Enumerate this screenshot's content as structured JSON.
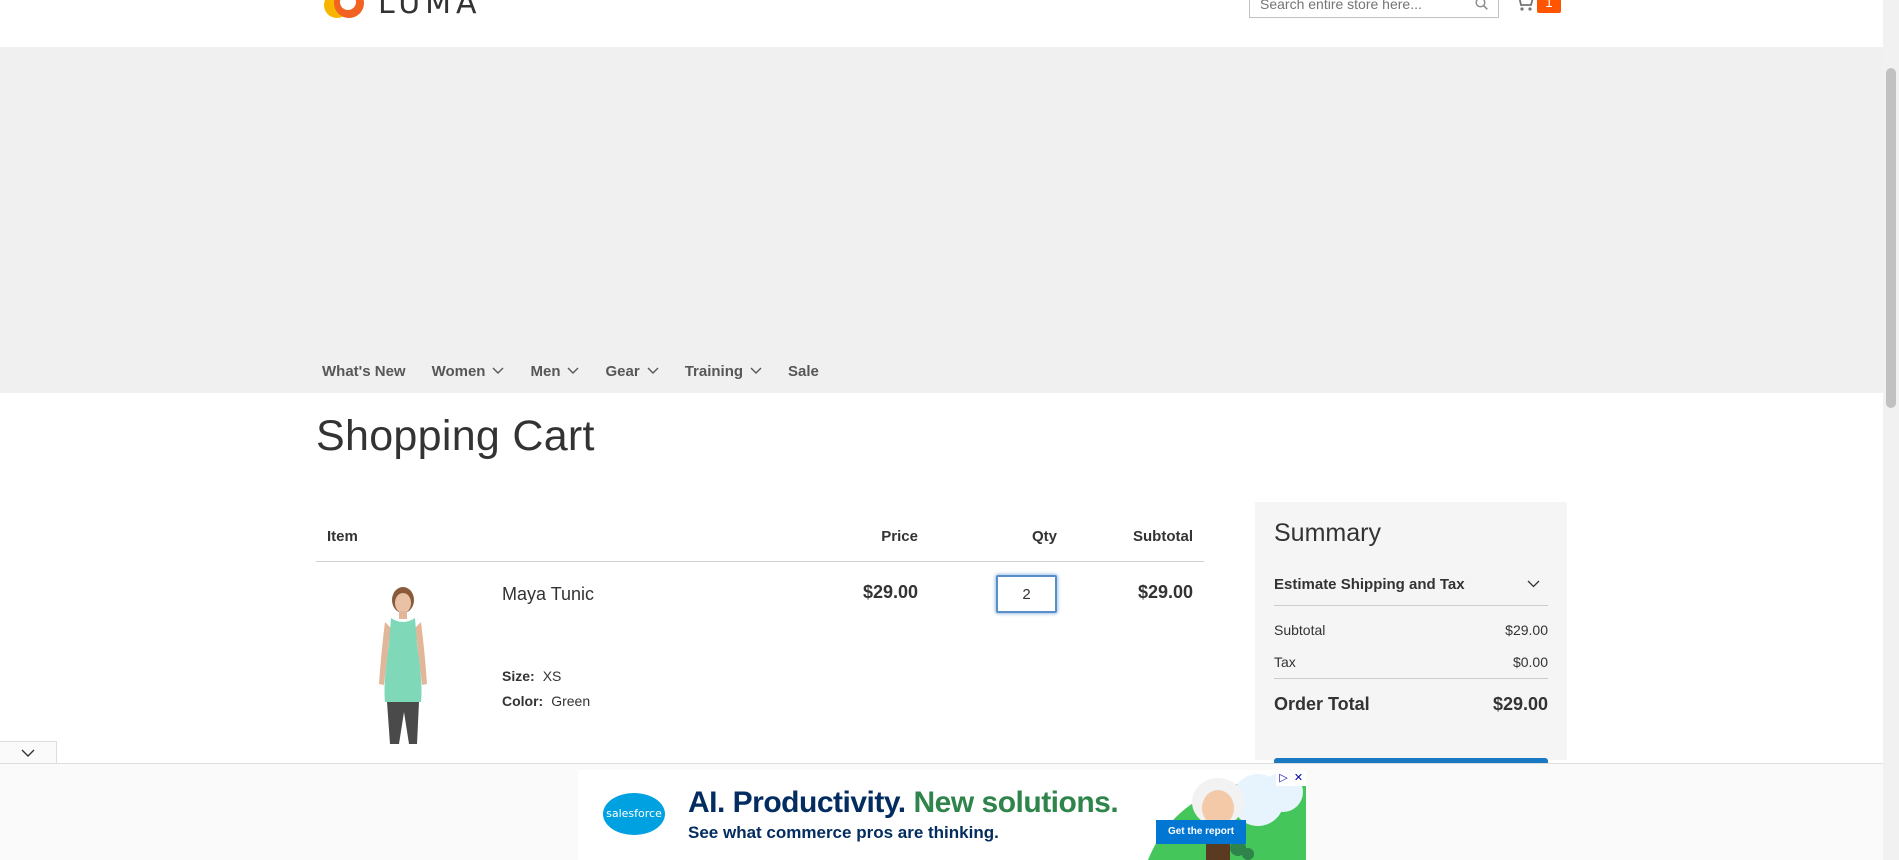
{
  "header": {
    "logo_text": "LUMA",
    "search_placeholder": "Search entire store here...",
    "cart_count": "1"
  },
  "nav": {
    "items": [
      {
        "label": "What's New",
        "has_dropdown": false
      },
      {
        "label": "Women",
        "has_dropdown": true
      },
      {
        "label": "Men",
        "has_dropdown": true
      },
      {
        "label": "Gear",
        "has_dropdown": true
      },
      {
        "label": "Training",
        "has_dropdown": true
      },
      {
        "label": "Sale",
        "has_dropdown": false
      }
    ]
  },
  "page": {
    "title": "Shopping Cart"
  },
  "cart": {
    "columns": {
      "item": "Item",
      "price": "Price",
      "qty": "Qty",
      "subtotal": "Subtotal"
    },
    "items": [
      {
        "name": "Maya Tunic",
        "options": [
          {
            "label": "Size:",
            "value": "XS"
          },
          {
            "label": "Color:",
            "value": "Green"
          }
        ],
        "price": "$29.00",
        "qty": "2",
        "subtotal": "$29.00"
      }
    ]
  },
  "summary": {
    "title": "Summary",
    "estimate_label": "Estimate Shipping and Tax",
    "subtotal_label": "Subtotal",
    "subtotal_value": "$29.00",
    "tax_label": "Tax",
    "tax_value": "$0.00",
    "total_label": "Order Total",
    "total_value": "$29.00"
  },
  "ad": {
    "brand": "salesforce",
    "headline_part1": "AI. Productivity.",
    "headline_part2": "New solutions.",
    "subline": "See what commerce pros are thinking.",
    "cta": "Get the report"
  },
  "colors": {
    "accent": "#ff5501",
    "button_blue": "#1979c3",
    "band_grey": "#f0f0f0"
  }
}
